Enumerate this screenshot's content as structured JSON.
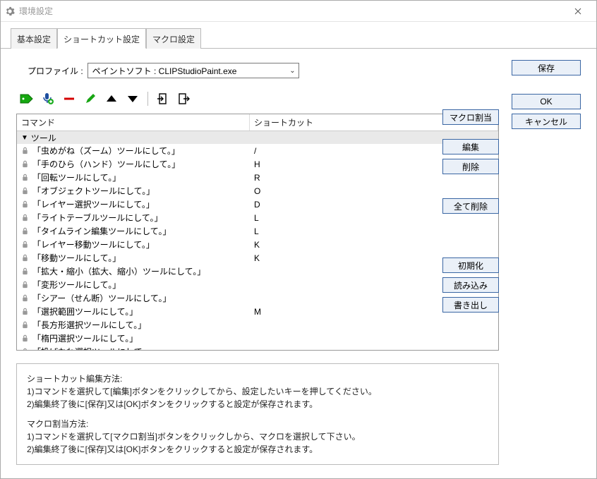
{
  "window": {
    "title": "環境設定"
  },
  "tabs": {
    "basic": "基本設定",
    "shortcut": "ショートカット設定",
    "macro": "マクロ設定",
    "active": "shortcut"
  },
  "profile": {
    "label": "プロファイル :",
    "value": "ペイントソフト : CLIPStudioPaint.exe"
  },
  "columns": {
    "command": "コマンド",
    "shortcut": "ショートカット"
  },
  "group": {
    "name": "ツール"
  },
  "items": [
    {
      "cmd": "「虫めがね（ズーム）ツールにして。」",
      "sc": "/"
    },
    {
      "cmd": "「手のひら（ハンド）ツールにして。」",
      "sc": "H"
    },
    {
      "cmd": "「回転ツールにして。」",
      "sc": "R"
    },
    {
      "cmd": "「オブジェクトツールにして。」",
      "sc": "O"
    },
    {
      "cmd": "「レイヤー選択ツールにして。」",
      "sc": "D"
    },
    {
      "cmd": "「ライトテーブルツールにして。」",
      "sc": "L"
    },
    {
      "cmd": "「タイムライン編集ツールにして。」",
      "sc": "L"
    },
    {
      "cmd": "「レイヤー移動ツールにして。」",
      "sc": "K"
    },
    {
      "cmd": "「移動ツールにして。」",
      "sc": "K"
    },
    {
      "cmd": "「拡大・縮小（拡大、縮小）ツールにして。」",
      "sc": ""
    },
    {
      "cmd": "「変形ツールにして。」",
      "sc": ""
    },
    {
      "cmd": "「シアー（せん断）ツールにして。」",
      "sc": ""
    },
    {
      "cmd": "「選択範囲ツールにして。」",
      "sc": "M"
    },
    {
      "cmd": "「長方形選択ツールにして。」",
      "sc": ""
    },
    {
      "cmd": "「楕円選択ツールにして。」",
      "sc": ""
    },
    {
      "cmd": "「投げなわ選択ツールにして。」",
      "sc": ""
    }
  ],
  "side": {
    "save": "保存",
    "ok": "OK",
    "cancel": "キャンセル",
    "assign_macro": "マクロ割当",
    "edit": "編集",
    "delete": "削除",
    "delete_all": "全て削除",
    "reset": "初期化",
    "import": "読み込み",
    "export": "書き出し"
  },
  "help": {
    "h1": "ショートカット編集方法:",
    "l1": "1)コマンドを選択して[編集]ボタンをクリックしてから、設定したいキーを押してください。",
    "l2": "2)編集終了後に[保存]又は[OK]ボタンをクリックすると設定が保存されます。",
    "h2": "マクロ割当方法:",
    "l3": "1)コマンドを選択して[マクロ割当]ボタンをクリックしから、マクロを選択して下さい。",
    "l4": "2)編集終了後に[保存]又は[OK]ボタンをクリックすると設定が保存されます。"
  }
}
